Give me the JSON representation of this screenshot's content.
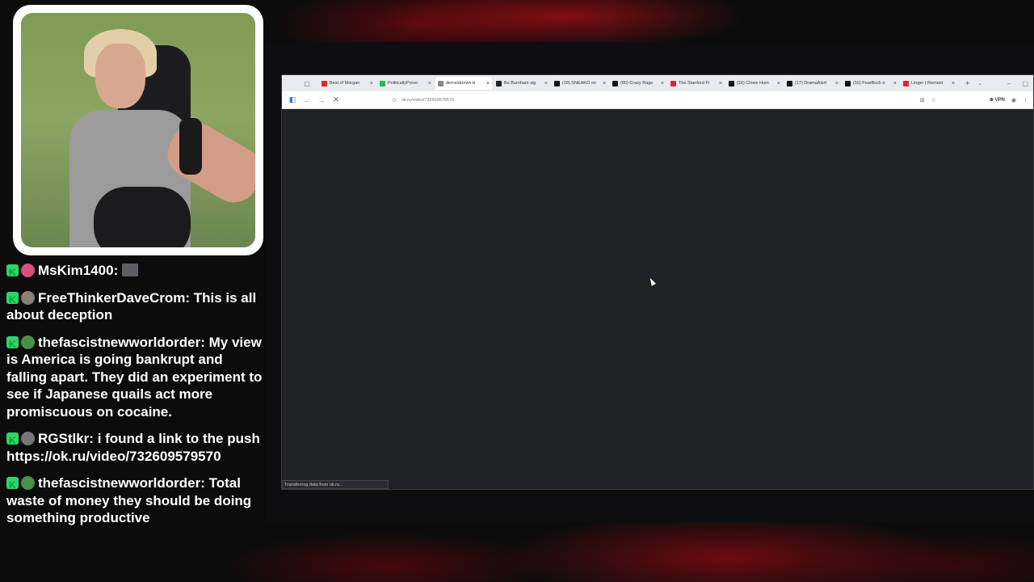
{
  "browser": {
    "tabs": [
      {
        "title": "Best of Morgan",
        "color": "#e0262b",
        "active": false
      },
      {
        "title": "PoliticallyProvo",
        "color": "#2db84d",
        "active": false
      },
      {
        "title": "demesbrown.tt",
        "color": "#888888",
        "active": true
      },
      {
        "title": "Bo Burnham sig",
        "color": "#222222",
        "active": false
      },
      {
        "title": "(18) SNEAKO on",
        "color": "#111111",
        "active": false
      },
      {
        "title": "(80) Crazy Rage",
        "color": "#111111",
        "active": false
      },
      {
        "title": "The Stanford Pr",
        "color": "#e0262b",
        "active": false
      },
      {
        "title": "(16) Clown Hum",
        "color": "#111111",
        "active": false
      },
      {
        "title": "(17) DramaAlert",
        "color": "#111111",
        "active": false
      },
      {
        "title": "(16) FearBuck o",
        "color": "#111111",
        "active": false
      },
      {
        "title": "Linger ( Remast",
        "color": "#e0262b",
        "active": false
      }
    ],
    "url": "ok.ru/video/732609579570",
    "vpn_label": "VPN",
    "status_text": "Transferring data from ok.ru..."
  },
  "chat": {
    "messages": [
      {
        "user": "MsKim1400",
        "text": "",
        "avatar_color": "#d94f7a",
        "emote": true
      },
      {
        "user": "FreeThinkerDaveCrom",
        "text": "This is all about deception",
        "avatar_color": "#8a7f74",
        "emote": false
      },
      {
        "user": "thefascistnewworldorder",
        "text": "My view is America is going bankrupt and falling apart. They did an experiment to see if Japanese quails act more promiscuous on cocaine.",
        "avatar_color": "#4a8f4a",
        "emote": false
      },
      {
        "user": "RGStlkr",
        "text": "i found a link to the push https://ok.ru/video/732609579570",
        "avatar_color": "#777777",
        "emote": false
      },
      {
        "user": "thefascistnewworldorder",
        "text": "Total waste of money they should be doing something productive",
        "avatar_color": "#4a8f4a",
        "emote": false
      }
    ]
  }
}
